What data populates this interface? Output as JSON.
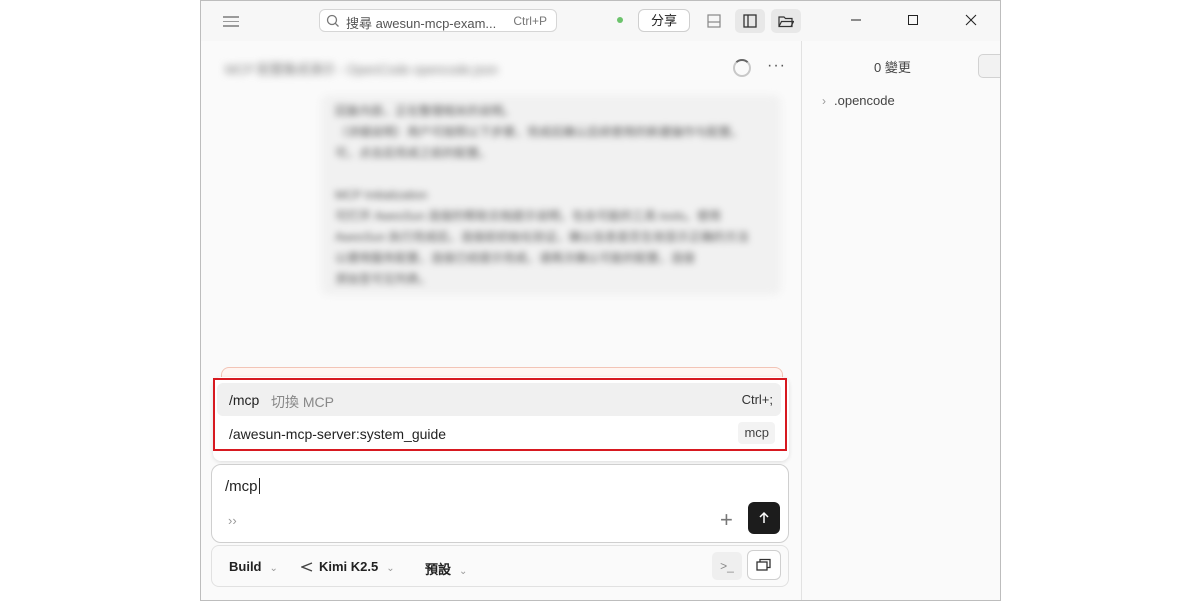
{
  "titlebar": {
    "search_placeholder": "搜尋 awesun-mcp-exam...",
    "search_shortcut": "Ctrl+P",
    "share_label": "分享"
  },
  "session": {
    "title": "MCP 配置集成演示 - OpenCode opencode.json"
  },
  "message": {
    "lines": [
      "回复内容，正在整理相关的说明。",
      "（详细说明）用户可按照以下步骤，完成后确认后续使用的新建操作与配置。",
      "可，点击后完成之前的配置。",
      "",
      "MCP Initialization",
      "可打开 AwesSun 连接的帮助文档提示说明，包含可能的工具 tools。使用",
      "AwesSun 执行完成后，连接前初始化验证，确认信息是否生效显示正确的方法",
      "以便用服务配置，连接已经提示完成，请再次确认可能的配置，连接",
      "添加至可见列表。"
    ]
  },
  "popup": {
    "items": [
      {
        "command": "/mcp",
        "description": "切換 MCP",
        "shortcut": "Ctrl+;"
      },
      {
        "command": "/awesun-mcp-server:system_guide",
        "tag": "mcp"
      }
    ]
  },
  "composer": {
    "text": "/mcp",
    "chevron": "››"
  },
  "bottom_toolbar": {
    "agent": "Build",
    "model": "Kimi K2.5",
    "variant": "預設"
  },
  "side_panel": {
    "changes_label": "0 變更",
    "tree_item": ".opencode"
  },
  "colors": {
    "highlight_border": "#d71920",
    "status_dot": "#6cc36c",
    "send_button": "#1c1c1c"
  }
}
